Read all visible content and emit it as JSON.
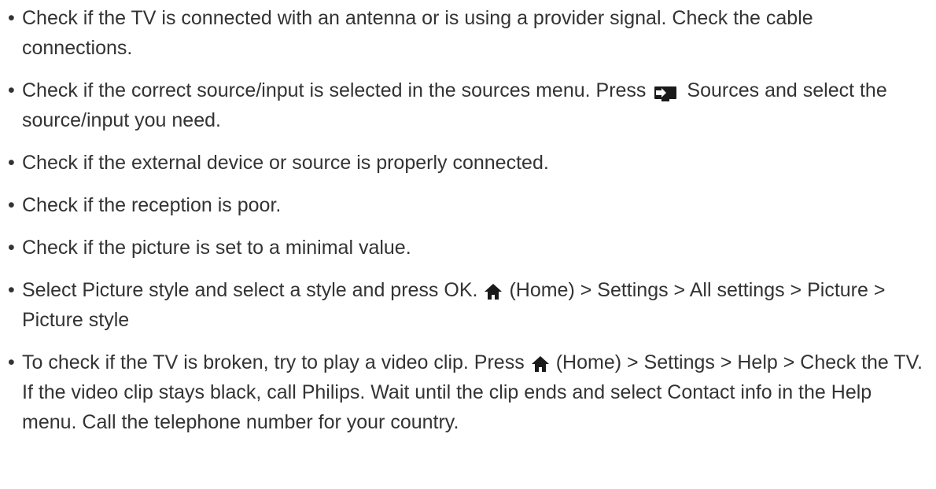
{
  "items": [
    {
      "text": "Check if the TV is connected with an antenna or is using a provider signal. Check the cable connections."
    },
    {
      "before": "Check if the correct source/input is selected in the sources menu. Press",
      "icon": "sources-icon",
      "after": "Sources and select the source/input you need."
    },
    {
      "text": "Check if the external device or source is properly connected."
    },
    {
      "text": "Check if the reception is poor."
    },
    {
      "text": "Check if the picture is set to a minimal value."
    },
    {
      "before": "Select Picture style and select a style and press OK.",
      "icon": "home-icon",
      "after": "(Home) > Settings > All settings > Picture > Picture style"
    },
    {
      "before": "To check if the TV is broken, try to play a video clip. Press",
      "icon": "home-icon",
      "after": "(Home) > Settings > Help > Check the TV. If the video clip stays black, call Philips. Wait until the clip ends and select Contact info in the Help menu. Call the telephone number for your country."
    }
  ]
}
